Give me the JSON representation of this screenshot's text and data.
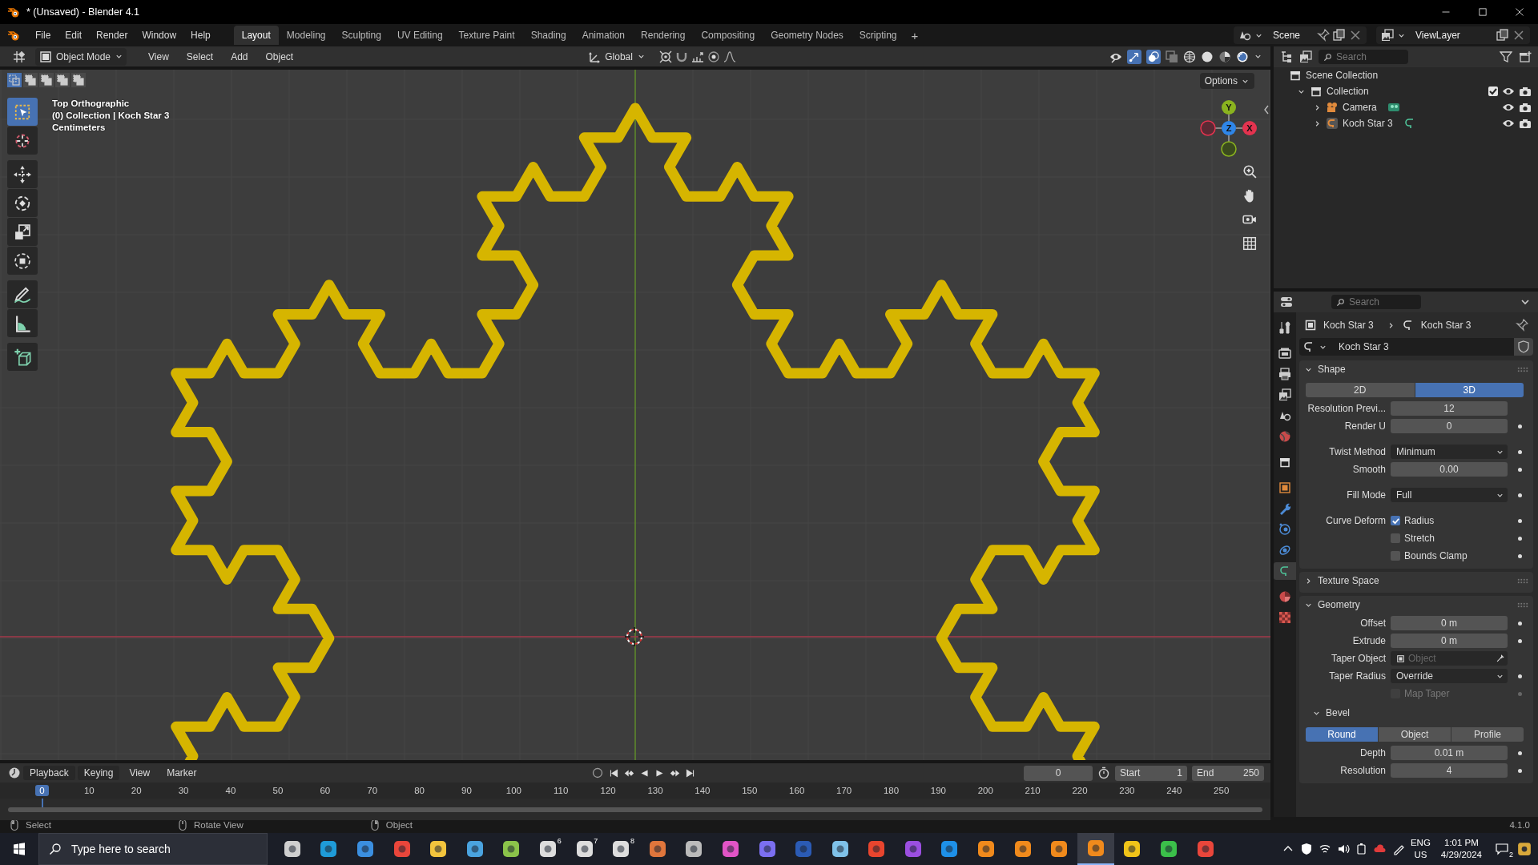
{
  "window": {
    "title": "* (Unsaved) - Blender 4.1"
  },
  "menu": [
    "File",
    "Edit",
    "Render",
    "Window",
    "Help"
  ],
  "workspaces": [
    {
      "label": "Layout",
      "selected": true
    },
    {
      "label": "Modeling",
      "selected": false
    },
    {
      "label": "Sculpting",
      "selected": false
    },
    {
      "label": "UV Editing",
      "selected": false
    },
    {
      "label": "Texture Paint",
      "selected": false
    },
    {
      "label": "Shading",
      "selected": false
    },
    {
      "label": "Animation",
      "selected": false
    },
    {
      "label": "Rendering",
      "selected": false
    },
    {
      "label": "Compositing",
      "selected": false
    },
    {
      "label": "Geometry Nodes",
      "selected": false
    },
    {
      "label": "Scripting",
      "selected": false
    }
  ],
  "add_workspace": "+",
  "scene": "Scene",
  "view_layer": "ViewLayer",
  "viewport_header": {
    "mode": "Object Mode",
    "menus": [
      "View",
      "Select",
      "Add",
      "Object"
    ],
    "orientation": "Global"
  },
  "viewport": {
    "overlay_text": [
      "Top Orthographic",
      "(0) Collection | Koch Star 3",
      "Centimeters"
    ],
    "options": "Options",
    "gizmo_axes": [
      {
        "label": "Y",
        "color": "#8ab31f"
      },
      {
        "label": "Z",
        "color": "#2f86e8"
      },
      {
        "label": "X",
        "color": "#e4334f"
      }
    ]
  },
  "outliner": {
    "search_placeholder": "Search",
    "tree": {
      "label": "Scene Collection",
      "kind": "scene_collection",
      "children": [
        {
          "label": "Collection",
          "kind": "collection",
          "expanded": true,
          "checked": true,
          "children": [
            {
              "label": "Camera",
              "kind": "camera",
              "expanded": false
            },
            {
              "label": "Koch Star 3",
              "kind": "curve",
              "expanded": false
            }
          ]
        }
      ]
    }
  },
  "properties": {
    "search_placeholder": "Search",
    "tabs": [
      {
        "kind": "tool",
        "selected": false
      },
      {
        "kind": "render",
        "selected": false
      },
      {
        "kind": "output",
        "selected": false
      },
      {
        "kind": "view_layer",
        "selected": false
      },
      {
        "kind": "scene",
        "selected": false
      },
      {
        "kind": "world",
        "selected": false
      },
      {
        "kind": "collection",
        "selected": false
      },
      {
        "kind": "object",
        "selected": false
      },
      {
        "kind": "modifiers",
        "selected": false
      },
      {
        "kind": "particles",
        "selected": false
      },
      {
        "kind": "physics",
        "selected": false
      },
      {
        "kind": "data",
        "selected": true
      },
      {
        "kind": "material",
        "selected": false
      },
      {
        "kind": "texture",
        "selected": false
      }
    ],
    "breadcrumb": [
      "Koch Star 3",
      "Koch Star 3"
    ],
    "datablock": "Koch Star 3",
    "panels": [
      {
        "title": "Shape",
        "expanded": true,
        "rows": [
          {
            "kind": "segmented",
            "options": [
              {
                "label": "2D",
                "selected": false
              },
              {
                "label": "3D",
                "selected": true
              }
            ]
          },
          {
            "kind": "number",
            "label": "Resolution Previ...",
            "value": "12",
            "keyframe": false
          },
          {
            "kind": "number",
            "label": "Render U",
            "value": "0",
            "keyframe": true
          },
          {
            "kind": "gap"
          },
          {
            "kind": "dropdown",
            "label": "Twist Method",
            "value": "Minimum",
            "keyframe": true
          },
          {
            "kind": "number",
            "label": "Smooth",
            "value": "0.00",
            "keyframe": true
          },
          {
            "kind": "gap"
          },
          {
            "kind": "dropdown",
            "label": "Fill Mode",
            "value": "Full",
            "keyframe": true
          },
          {
            "kind": "gap"
          },
          {
            "kind": "checkbox",
            "label": "Curve Deform",
            "text": "Radius",
            "checked": true,
            "disabled": false,
            "keyframe": true
          },
          {
            "kind": "checkbox",
            "text": "Stretch",
            "checked": false,
            "disabled": false,
            "keyframe": true
          },
          {
            "kind": "checkbox",
            "text": "Bounds Clamp",
            "checked": false,
            "disabled": false,
            "keyframe": true
          }
        ]
      },
      {
        "title": "Texture Space",
        "expanded": false
      },
      {
        "title": "Geometry",
        "expanded": true,
        "rows": [
          {
            "kind": "number",
            "label": "Offset",
            "value": "0 m",
            "keyframe": true
          },
          {
            "kind": "number",
            "label": "Extrude",
            "value": "0 m",
            "keyframe": true
          },
          {
            "kind": "object",
            "label": "Taper Object",
            "placeholder": "Object"
          },
          {
            "kind": "dropdown",
            "label": "Taper Radius",
            "value": "Override",
            "keyframe": true
          },
          {
            "kind": "checkbox",
            "text": "Map Taper",
            "checked": false,
            "disabled": true,
            "keyframe": true
          },
          {
            "kind": "subpanel",
            "title": "Bevel",
            "expanded": true
          },
          {
            "kind": "segmented",
            "options": [
              {
                "label": "Round",
                "selected": true
              },
              {
                "label": "Object",
                "selected": false
              },
              {
                "label": "Profile",
                "selected": false
              }
            ]
          },
          {
            "kind": "number",
            "label": "Depth",
            "value": "0.01 m",
            "keyframe": true
          },
          {
            "kind": "number",
            "label": "Resolution",
            "value": "4",
            "keyframe": true
          }
        ]
      }
    ]
  },
  "timeline": {
    "menus": [
      "Playback",
      "Keying",
      "View",
      "Marker"
    ],
    "current_frame": "0",
    "start_label": "Start",
    "start": "1",
    "end_label": "End",
    "end": "250",
    "ruler_current": "0",
    "ruler_ticks": [
      "10",
      "20",
      "30",
      "40",
      "50",
      "60",
      "70",
      "80",
      "90",
      "100",
      "110",
      "120",
      "130",
      "140",
      "150",
      "160",
      "170",
      "180",
      "190",
      "200",
      "210",
      "220",
      "230",
      "240",
      "250"
    ]
  },
  "status_bar": {
    "hints": [
      "Select",
      "Rotate View",
      "Object"
    ],
    "version": "4.1.0"
  },
  "taskbar": {
    "search_placeholder": "Type here to search",
    "apps": [
      {
        "color": "#cfcfcf",
        "selected": false
      },
      {
        "color": "#1f9bd8",
        "selected": false
      },
      {
        "color": "#3b8fe0",
        "selected": false
      },
      {
        "color": "#e9463b",
        "selected": false
      },
      {
        "color": "#f2c43d",
        "selected": false
      },
      {
        "color": "#4aa3df",
        "selected": false
      },
      {
        "color": "#8bc34a",
        "selected": false
      },
      {
        "color": "#dddddd",
        "badge": "6",
        "selected": false
      },
      {
        "color": "#dddddd",
        "badge": "7",
        "selected": false
      },
      {
        "color": "#dddddd",
        "badge": "8",
        "selected": false
      },
      {
        "color": "#e0763c",
        "selected": false
      },
      {
        "color": "#bbbbbb",
        "selected": false
      },
      {
        "color": "#e154c6",
        "selected": false
      },
      {
        "color": "#7b6ff0",
        "selected": false
      },
      {
        "color": "#2b5bb5",
        "selected": false
      },
      {
        "color": "#7fc1e8",
        "selected": false
      },
      {
        "color": "#e8452e",
        "selected": false
      },
      {
        "color": "#9b4fe0",
        "selected": false
      },
      {
        "color": "#1e90e8",
        "selected": false
      },
      {
        "color": "#f08a1c",
        "selected": false
      },
      {
        "color": "#f08a1c",
        "selected": false
      },
      {
        "color": "#f08a1c",
        "selected": false
      },
      {
        "color": "#f08a1c",
        "selected": true
      },
      {
        "color": "#f0c419",
        "selected": false
      },
      {
        "color": "#3bbf4a",
        "selected": false
      },
      {
        "color": "#e9463b",
        "selected": false
      }
    ],
    "language": "ENG",
    "region": "US",
    "time": "1:01 PM",
    "date": "4/29/2024",
    "notifications": "2"
  }
}
